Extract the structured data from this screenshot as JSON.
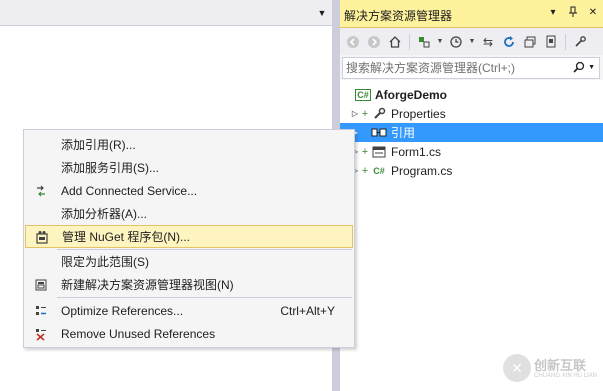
{
  "editor": {
    "dropdown_icon": "chevron-down-icon"
  },
  "solution_explorer": {
    "title": "解决方案资源管理器",
    "title_buttons": [
      "dropdown",
      "pin",
      "close"
    ],
    "toolbar_icons": [
      "back-icon",
      "forward-icon",
      "home-icon",
      "sync-icon",
      "history-icon",
      "pending-changes-icon",
      "refresh-icon",
      "collapse-all-icon",
      "show-all-files-icon",
      "properties-icon"
    ],
    "search": {
      "placeholder": "搜索解决方案资源管理器(Ctrl+;)"
    },
    "tree": [
      {
        "label": "AforgeDemo",
        "icon": "csharp-project-icon",
        "bold": true,
        "selected": false
      },
      {
        "label": "Properties",
        "icon": "wrench-icon",
        "bold": false,
        "selected": false
      },
      {
        "label": "引用",
        "icon": "references-icon",
        "bold": false,
        "selected": true
      },
      {
        "label": "Form1.cs",
        "icon": "form-icon",
        "bold": false,
        "selected": false
      },
      {
        "label": "Program.cs",
        "icon": "csharp-file-icon",
        "bold": false,
        "selected": false
      }
    ]
  },
  "context_menu": {
    "items": [
      {
        "label": "添加引用(R)...",
        "icon": "",
        "shortcut": "",
        "highlighted": false
      },
      {
        "label": "添加服务引用(S)...",
        "icon": "",
        "shortcut": "",
        "highlighted": false
      },
      {
        "label": "Add Connected Service...",
        "icon": "connected-service-icon",
        "shortcut": "",
        "highlighted": false
      },
      {
        "label": "添加分析器(A)...",
        "icon": "",
        "shortcut": "",
        "highlighted": false
      },
      {
        "label": "管理 NuGet 程序包(N)...",
        "icon": "nuget-icon",
        "shortcut": "",
        "highlighted": true
      },
      {
        "label": "限定为此范围(S)",
        "icon": "",
        "shortcut": "",
        "highlighted": false
      },
      {
        "label": "新建解决方案资源管理器视图(N)",
        "icon": "new-view-icon",
        "shortcut": "",
        "highlighted": false
      },
      {
        "label": "Optimize References...",
        "icon": "optimize-icon",
        "shortcut": "Ctrl+Alt+Y",
        "highlighted": false
      },
      {
        "label": "Remove Unused References",
        "icon": "remove-references-icon",
        "shortcut": "",
        "highlighted": false
      }
    ]
  },
  "watermark": {
    "text": "创新互联",
    "sub": "CHUANG XIN HU LIAN"
  },
  "colors": {
    "selection": "#3399ff",
    "title_active": "#fff29d",
    "menu_highlight": "#fdf4bf",
    "menu_bg": "#f5f5f5"
  }
}
